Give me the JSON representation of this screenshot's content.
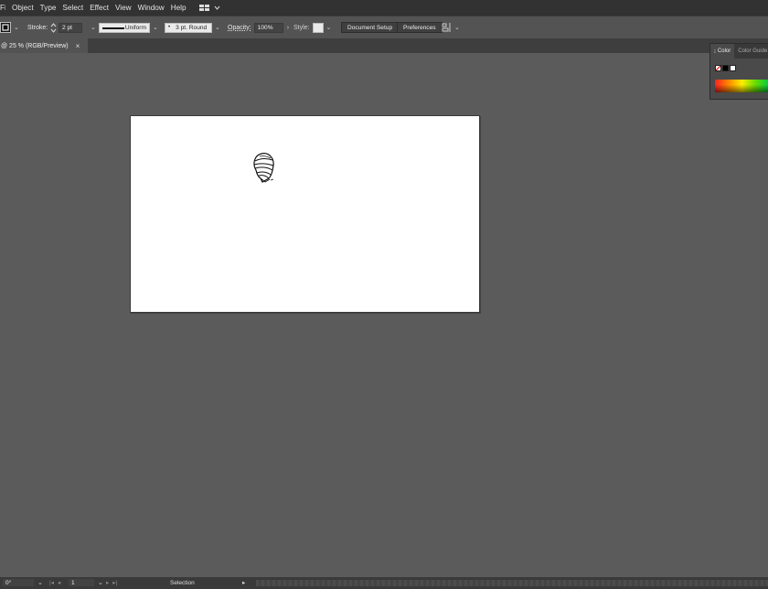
{
  "menubar": {
    "items": [
      "File",
      "Object",
      "Type",
      "Select",
      "Effect",
      "View",
      "Window",
      "Help"
    ],
    "workspace_icon": "workspace-grid-icon"
  },
  "controlbar": {
    "stroke_label": "Stroke:",
    "stroke_value": "2 pt",
    "profile_label": "Uniform",
    "brush_label": "3 pt. Round",
    "opacity_label": "Opacity:",
    "opacity_value": "100%",
    "style_label": "Style:",
    "document_setup": "Document Setup",
    "preferences": "Preferences"
  },
  "tab": {
    "title": "@ 25 % (RGB/Preview)",
    "close": "×"
  },
  "color_panel": {
    "tab_color": "Color",
    "tab_guide": "Color Guide"
  },
  "statusbar": {
    "rotation": "0°",
    "artboard_number": "1",
    "tool": "Selection"
  },
  "colors": {
    "ui_dark": "#323232",
    "canvas": "#5b5b5b",
    "artboard": "#ffffff"
  }
}
